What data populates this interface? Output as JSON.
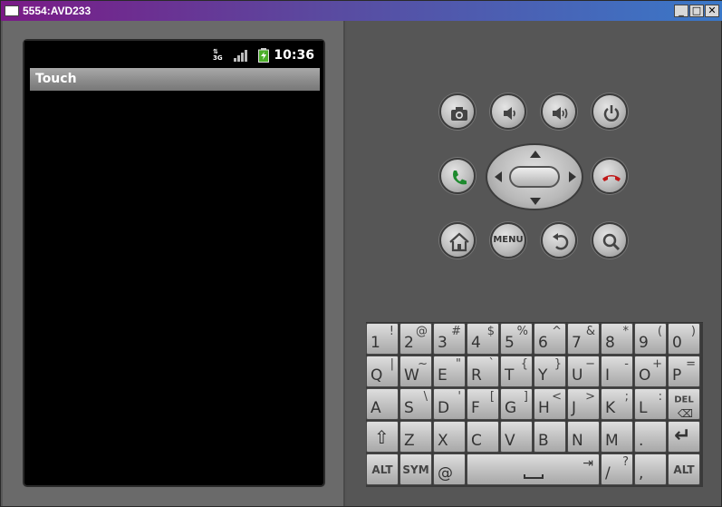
{
  "window": {
    "title": "5554:AVD233",
    "minimize_label": "_",
    "maximize_label": "□",
    "close_label": "✕"
  },
  "device": {
    "status_bar": {
      "time": "10:36",
      "network_badge": "3G",
      "icons": [
        "network-3g-icon",
        "signal-strength-icon",
        "battery-charging-icon"
      ]
    },
    "app_title": "Touch"
  },
  "hardware_buttons": [
    {
      "name": "camera-button",
      "icon": "camera-icon"
    },
    {
      "name": "volume-down-button",
      "icon": "volume-down-icon"
    },
    {
      "name": "volume-up-button",
      "icon": "volume-up-icon"
    },
    {
      "name": "power-button",
      "icon": "power-icon"
    },
    {
      "name": "call-button",
      "icon": "call-icon"
    },
    {
      "name": "end-call-button",
      "icon": "end-call-icon"
    },
    {
      "name": "home-button",
      "icon": "home-icon"
    },
    {
      "name": "menu-button",
      "label": "MENU"
    },
    {
      "name": "back-button",
      "icon": "back-icon"
    },
    {
      "name": "search-button",
      "icon": "search-icon"
    }
  ],
  "keyboard": {
    "row1": [
      {
        "m": "1",
        "s": "!"
      },
      {
        "m": "2",
        "s": "@"
      },
      {
        "m": "3",
        "s": "#"
      },
      {
        "m": "4",
        "s": "$"
      },
      {
        "m": "5",
        "s": "%"
      },
      {
        "m": "6",
        "s": "^"
      },
      {
        "m": "7",
        "s": "&"
      },
      {
        "m": "8",
        "s": "*"
      },
      {
        "m": "9",
        "s": "("
      },
      {
        "m": "0",
        "s": ")"
      }
    ],
    "row2": [
      {
        "m": "Q",
        "s": "|"
      },
      {
        "m": "W",
        "s": "~"
      },
      {
        "m": "E",
        "s": "\""
      },
      {
        "m": "R",
        "s": "`"
      },
      {
        "m": "T",
        "s": "{"
      },
      {
        "m": "Y",
        "s": "}"
      },
      {
        "m": "U",
        "s": "−"
      },
      {
        "m": "I",
        "s": "-"
      },
      {
        "m": "O",
        "s": "+"
      },
      {
        "m": "P",
        "s": "="
      }
    ],
    "row3": [
      {
        "m": "A",
        "s": ""
      },
      {
        "m": "S",
        "s": "\\"
      },
      {
        "m": "D",
        "s": "'"
      },
      {
        "m": "F",
        "s": "["
      },
      {
        "m": "G",
        "s": "]"
      },
      {
        "m": "H",
        "s": "<"
      },
      {
        "m": "J",
        "s": ">"
      },
      {
        "m": "K",
        "s": ";"
      },
      {
        "m": "L",
        "s": ":"
      }
    ],
    "del_label": "DEL",
    "row4": [
      {
        "m": "Z",
        "s": ""
      },
      {
        "m": "X",
        "s": ""
      },
      {
        "m": "C",
        "s": ""
      },
      {
        "m": "V",
        "s": ""
      },
      {
        "m": "B",
        "s": ""
      },
      {
        "m": "N",
        "s": ""
      },
      {
        "m": "M",
        "s": ""
      },
      {
        "m": ".",
        "s": ""
      }
    ],
    "alt_label": "ALT",
    "sym_label": "SYM",
    "at_label": "@",
    "slash_key": {
      "m": "/",
      "s": "?"
    },
    "comma_label": ",",
    "alt_right_label": "ALT"
  }
}
